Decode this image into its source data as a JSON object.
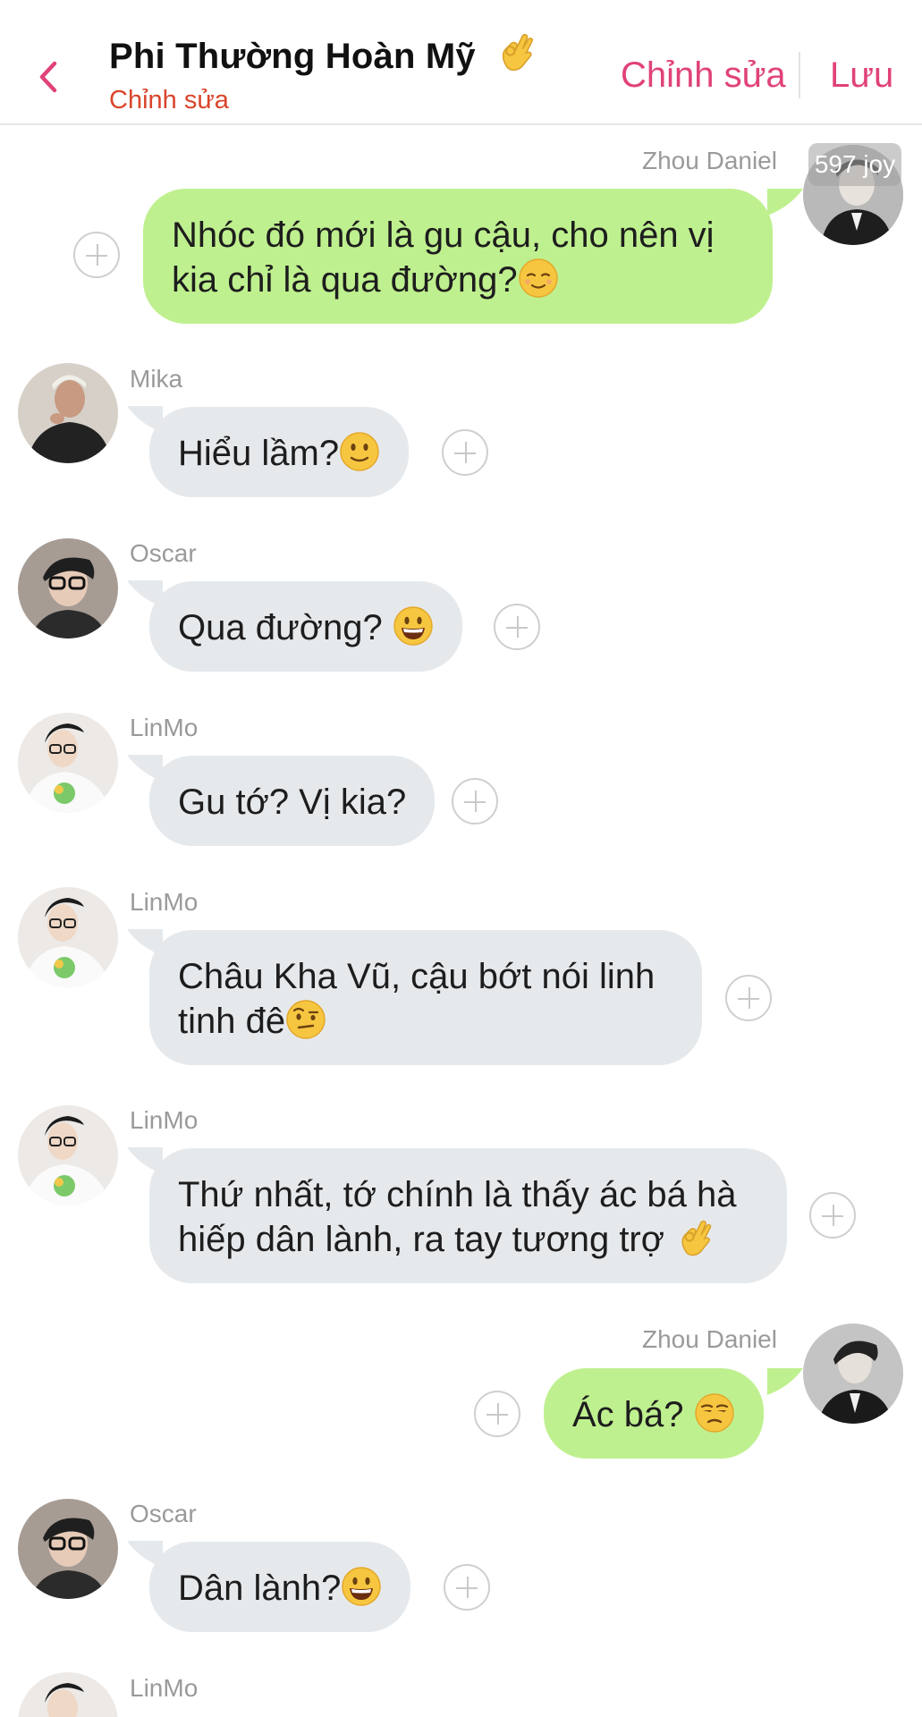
{
  "header": {
    "title": "Phi Thường Hoàn Mỹ",
    "title_emoji": "ok-hand",
    "subtitle": "Chỉnh sửa",
    "edit_label": "Chỉnh sửa",
    "save_label": "Lưu",
    "accent": "#e0427a",
    "subtitle_color": "#d9452b"
  },
  "colors": {
    "incoming_bubble": "#e6e9ec",
    "outgoing_bubble": "#bff08f"
  },
  "messages": [
    {
      "sender": "Zhou Daniel",
      "direction": "out",
      "text": "Nhóc đó mới là gu cậu, cho nên vị kia chỉ là qua đường?",
      "emoji": "relieved-face",
      "badge": "597 joy"
    },
    {
      "sender": "Mika",
      "direction": "in",
      "text": "Hiểu lầm?",
      "emoji": "slightly-smiling-face"
    },
    {
      "sender": "Oscar",
      "direction": "in",
      "text": "Qua đường? ",
      "emoji": "grinning-face"
    },
    {
      "sender": "LinMo",
      "direction": "in",
      "text": "Gu tớ? Vị kia?",
      "emoji": ""
    },
    {
      "sender": "LinMo",
      "direction": "in",
      "text": "Châu Kha Vũ, cậu bớt nói linh tinh đê",
      "emoji": "face-with-raised-eyebrow"
    },
    {
      "sender": "LinMo",
      "direction": "in",
      "text": "Thứ nhất, tớ chính là thấy ác bá hà hiếp dân lành, ra tay tương trợ ",
      "emoji": "ok-hand"
    },
    {
      "sender": "Zhou Daniel",
      "direction": "out",
      "text": "Ác bá? ",
      "emoji": "unamused-face"
    },
    {
      "sender": "Oscar",
      "direction": "in",
      "text": "Dân lành?",
      "emoji": "grinning-face"
    },
    {
      "sender": "LinMo",
      "direction": "in",
      "text": "",
      "emoji": ""
    }
  ]
}
